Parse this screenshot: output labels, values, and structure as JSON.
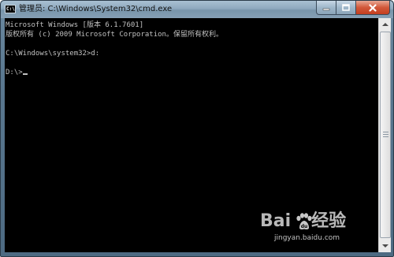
{
  "window": {
    "title": "管理员: C:\\Windows\\System32\\cmd.exe",
    "app_icon": "cmd-icon",
    "app_icon_text": "C:\\",
    "buttons": {
      "minimize_icon": "minimize-icon",
      "maximize_icon": "maximize-icon",
      "close_icon": "close-icon"
    },
    "colors": {
      "console_background": "#000000",
      "console_text": "#c0c0c0",
      "close_button": "#c33e1f"
    }
  },
  "console": {
    "lines": [
      "Microsoft Windows [版本 6.1.7601]",
      "版权所有 (c) 2009 Microsoft Corporation。保留所有权利。",
      "",
      "C:\\Windows\\system32>d:",
      "",
      "D:\\>"
    ]
  },
  "scrollbar": {
    "up_icon": "scroll-up-arrow-icon",
    "down_icon": "scroll-down-arrow-icon"
  },
  "watermark": {
    "brand_left": "Bai",
    "brand_right": "经验",
    "logo_icon": "baidu-paw-icon",
    "url": "jingyan.baidu.com"
  }
}
